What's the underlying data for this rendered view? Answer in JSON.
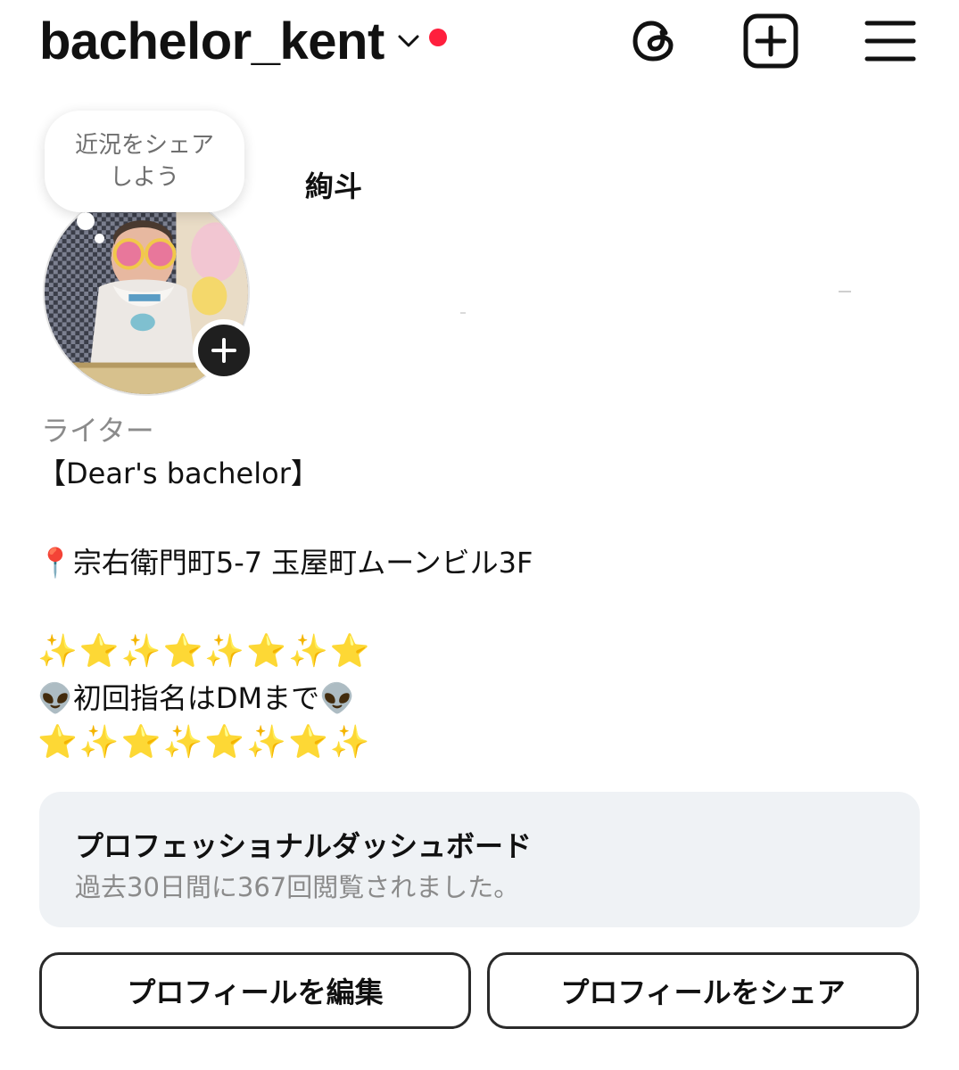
{
  "header": {
    "username": "bachelor_kent",
    "icons": {
      "account_switch": "chevron-down-icon",
      "notification": "red-dot",
      "threads": "threads-icon",
      "create": "plus-square-icon",
      "menu": "hamburger-menu-icon"
    },
    "notification_color": "#ff1f3d"
  },
  "profile": {
    "note_bubble": {
      "line1": "近況をシェア",
      "line2": "しよう"
    },
    "display_name": "絢斗",
    "category": "ライター",
    "bio": {
      "line1": "【Dear's bachelor】",
      "line2": "📍宗右衛門町5-7 玉屋町ムーンビル3F",
      "line3": "✨⭐✨⭐✨⭐✨⭐",
      "line4": "👽初回指名はDMまで👽",
      "line5": "⭐✨⭐✨⭐✨⭐✨"
    }
  },
  "dashboard": {
    "title": "プロフェッショナルダッシュボード",
    "subtitle": "過去30日間に367回閲覧されました。"
  },
  "buttons": {
    "edit_profile": "プロフィールを編集",
    "share_profile": "プロフィールをシェア"
  }
}
